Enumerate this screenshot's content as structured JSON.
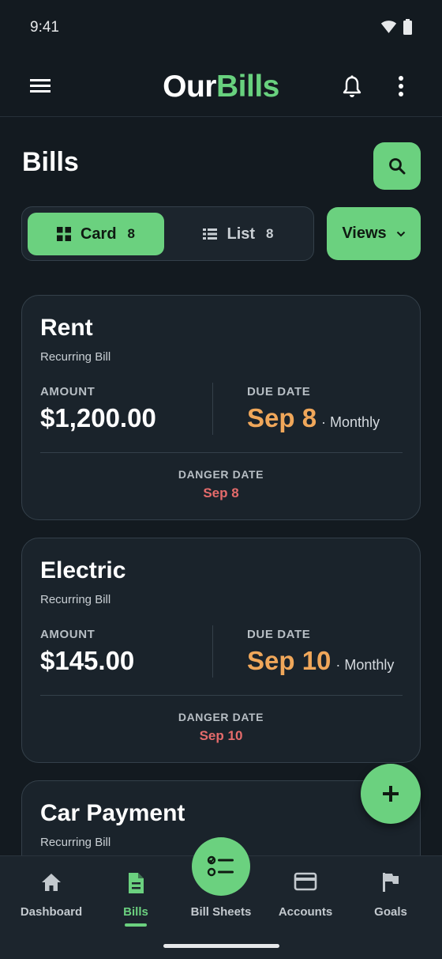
{
  "status_bar": {
    "time": "9:41"
  },
  "app_bar": {
    "brand_part1": "Our",
    "brand_part2": "Bills"
  },
  "page": {
    "title": "Bills"
  },
  "view_toggle": {
    "card_label": "Card",
    "card_count": "8",
    "list_label": "List",
    "list_count": "8",
    "selected": "Card"
  },
  "views_button": {
    "label": "Views"
  },
  "labels": {
    "amount": "AMOUNT",
    "due_date": "DUE DATE",
    "danger_date": "DANGER DATE"
  },
  "bills": [
    {
      "name": "Rent",
      "type": "Recurring Bill",
      "amount": "$1,200.00",
      "due_date": "Sep 8",
      "frequency": "· Monthly",
      "danger_date": "Sep 8"
    },
    {
      "name": "Electric",
      "type": "Recurring Bill",
      "amount": "$145.00",
      "due_date": "Sep 10",
      "frequency": "· Monthly",
      "danger_date": "Sep 10"
    },
    {
      "name": "Car Payment",
      "type": "Recurring Bill"
    }
  ],
  "bottom_nav": {
    "items": [
      {
        "label": "Dashboard",
        "icon": "home-icon"
      },
      {
        "label": "Bills",
        "icon": "document-icon",
        "active": true
      },
      {
        "label": "Bill Sheets",
        "icon": "checklist-icon"
      },
      {
        "label": "Accounts",
        "icon": "credit-card-icon"
      },
      {
        "label": "Goals",
        "icon": "flag-icon"
      }
    ]
  },
  "colors": {
    "accent": "#6bd17f",
    "background": "#131a20",
    "card": "#1a232b",
    "due_date": "#f0a75a",
    "danger_date": "#e56b6b"
  }
}
